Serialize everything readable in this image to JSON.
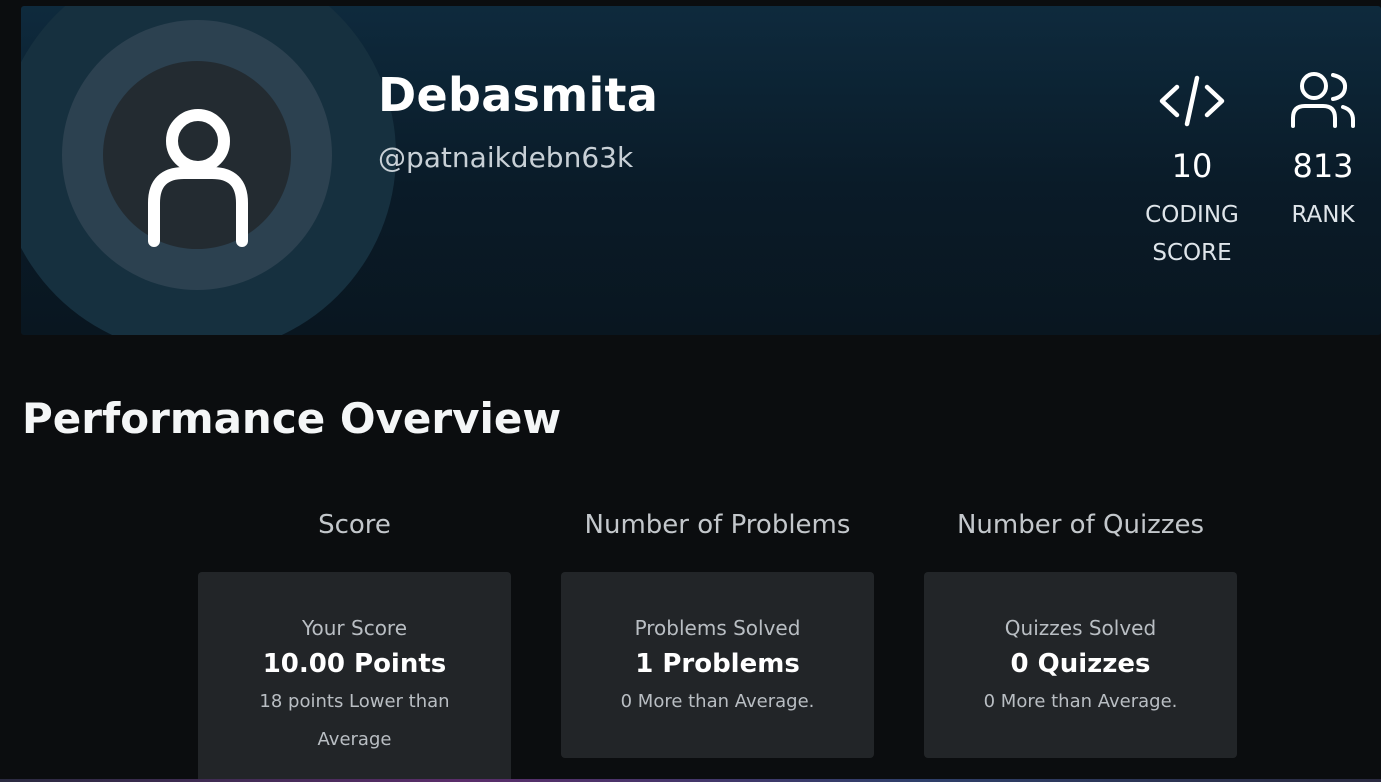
{
  "profile": {
    "name": "Debasmita",
    "handle": "@patnaikdebn63k",
    "avatar_icon": "user-icon"
  },
  "stats": {
    "coding_score": {
      "icon": "code-icon",
      "value": "10",
      "label_line1": "CODING",
      "label_line2": "SCORE"
    },
    "rank": {
      "icon": "users-icon",
      "value": "813",
      "label": "RANK"
    }
  },
  "overview": {
    "title": "Performance Overview",
    "columns": [
      {
        "heading": "Score",
        "label": "Your Score",
        "value": "10.00 Points",
        "note": "18 points Lower than Average"
      },
      {
        "heading": "Number of Problems",
        "label": "Problems Solved",
        "value": "1 Problems",
        "note": "0 More than Average."
      },
      {
        "heading": "Number of Quizzes",
        "label": "Quizzes Solved",
        "value": "0 Quizzes",
        "note": "0 More than Average."
      }
    ]
  }
}
